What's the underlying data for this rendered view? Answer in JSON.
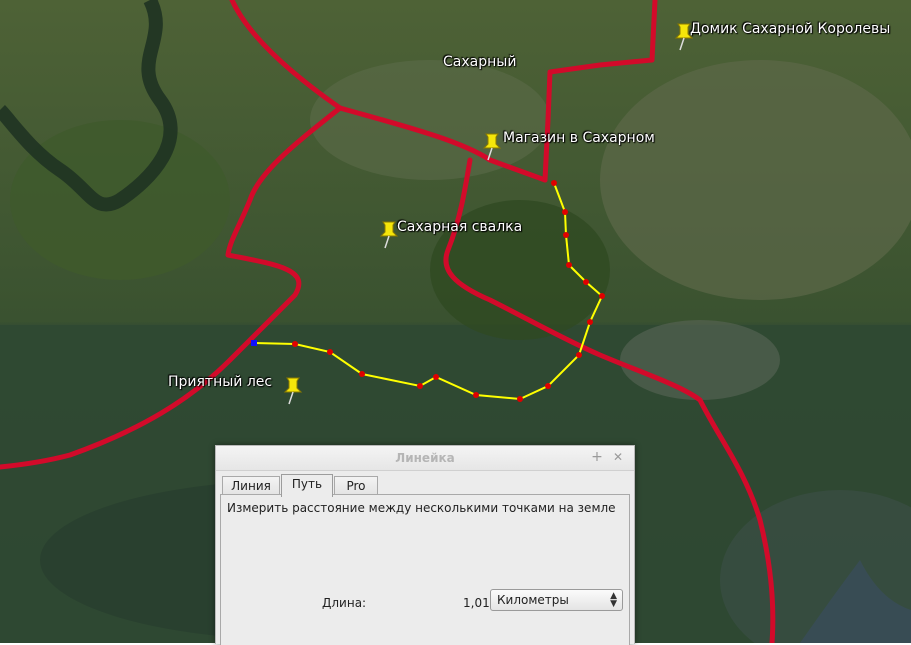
{
  "map": {
    "labels": {
      "domik": "Домик Сахарной Королевы",
      "sakharny": "Сахарный",
      "magazin": "Магазин в Сахарном",
      "svalka": "Сахарная свалка",
      "les": "Приятный лес"
    },
    "colors": {
      "road": "#d20a2a",
      "path": "#ffff00",
      "path_point": "#e00000",
      "start_point": "#1010ff",
      "pin": "#f5e60a"
    }
  },
  "dialog": {
    "title": "Линейка",
    "close_symbol": "✕",
    "maximize_symbol": "+",
    "tabs": [
      "Линия",
      "Путь",
      "Pro"
    ],
    "active_tab": "Путь",
    "description": "Измерить расстояние между несколькими точками на земле",
    "length_label": "Длина:",
    "length_value": "1,01",
    "units": "Километры"
  }
}
